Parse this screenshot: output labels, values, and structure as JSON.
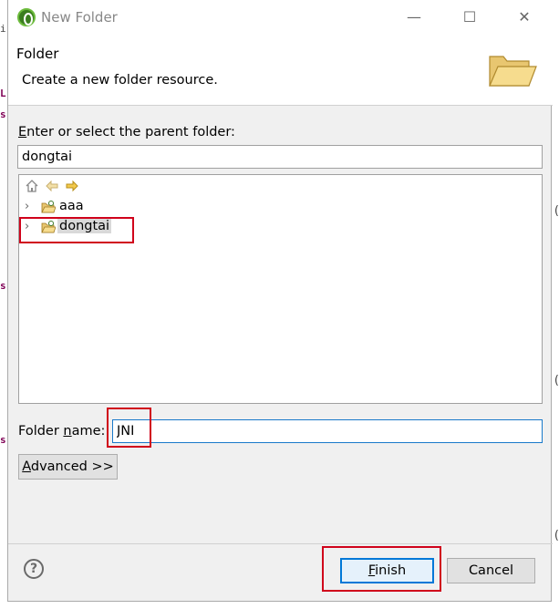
{
  "window": {
    "title": "New Folder",
    "minimize_glyph": "—",
    "maximize_glyph": "☐",
    "close_glyph": "✕"
  },
  "header": {
    "title": "Folder",
    "description": "Create a new folder resource."
  },
  "parent": {
    "label_underlined": "E",
    "label_rest": "nter or select the parent folder:",
    "value": "dongtai"
  },
  "tree": {
    "toolbar": {
      "home_icon": "home-icon",
      "back_icon": "back-arrow-icon",
      "forward_icon": "forward-arrow-icon"
    },
    "items": [
      {
        "label": "aaa",
        "expanded": false,
        "selected": false,
        "icon": "project-folder-icon"
      },
      {
        "label": "dongtai",
        "expanded": false,
        "selected": true,
        "icon": "project-folder-icon"
      }
    ]
  },
  "folder_name": {
    "label_pre": "Folder ",
    "label_underlined": "n",
    "label_post": "ame:",
    "value": "JNI"
  },
  "buttons": {
    "advanced_underlined": "A",
    "advanced_rest": "dvanced >>",
    "finish_underlined": "F",
    "finish_rest": "inish",
    "cancel": "Cancel",
    "help_glyph": "?"
  },
  "background": {
    "left_glyphs": [
      "i",
      "L",
      "s",
      "s",
      "s"
    ],
    "right_glyphs": [
      "(",
      "(",
      "("
    ]
  },
  "colors": {
    "highlight_box": "#d0021b",
    "focus_border": "#1979ca",
    "default_button_border": "#0078d7"
  }
}
